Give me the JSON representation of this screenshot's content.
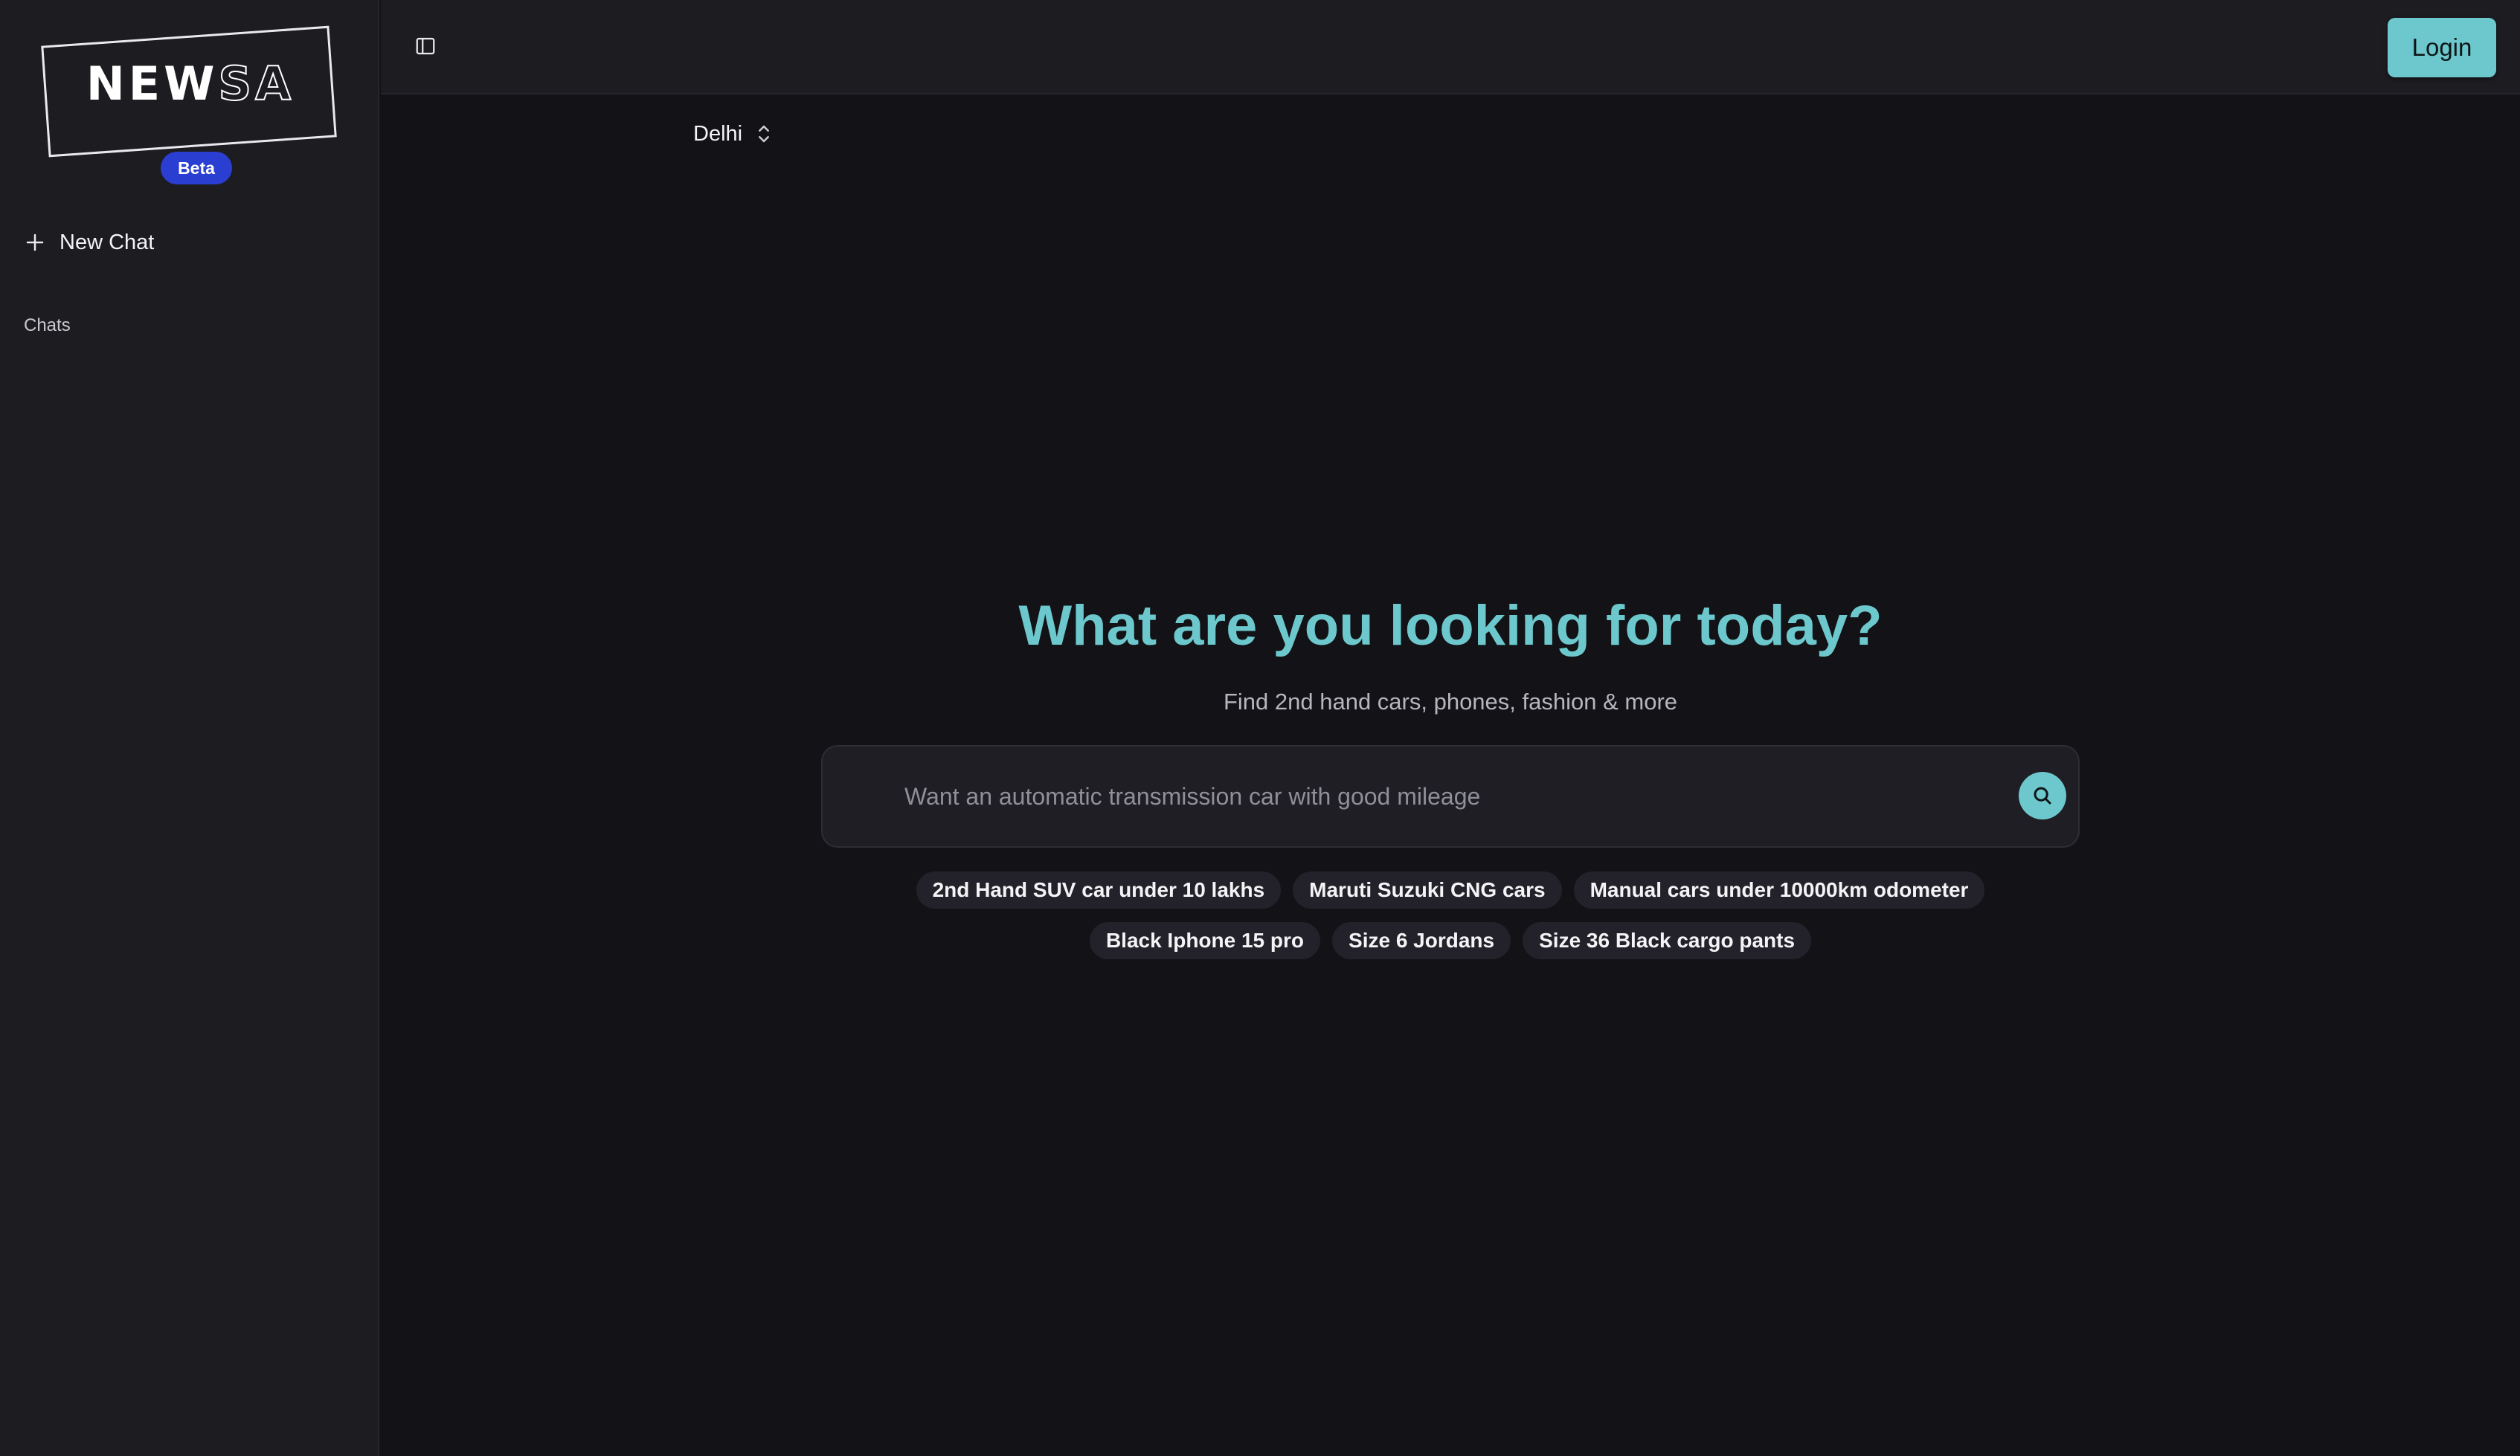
{
  "sidebar": {
    "logo": {
      "part1": "NEW",
      "part2": "SA"
    },
    "badge": "Beta",
    "new_chat_label": "New Chat",
    "chats_label": "Chats"
  },
  "topbar": {
    "login_label": "Login"
  },
  "location": {
    "selected": "Delhi"
  },
  "hero": {
    "title": "What are you looking for today?",
    "subtitle": "Find 2nd hand cars, phones, fashion & more"
  },
  "search": {
    "placeholder": "Want an automatic transmission car with good mileage",
    "value": ""
  },
  "suggestions": {
    "row1": [
      "2nd Hand SUV car under 10 lakhs",
      "Maruti Suzuki CNG cars",
      "Manual cars under 10000km odometer"
    ],
    "row2": [
      "Black Iphone 15 pro",
      "Size 6 Jordans",
      "Size 36 Black cargo pants"
    ]
  },
  "colors": {
    "accent": "#6cc8cc",
    "badge": "#2a3fd1",
    "sidebar_bg": "#1d1c21",
    "main_bg": "#131217"
  },
  "icons": {
    "new_chat": "plus-icon",
    "panel_toggle": "sidebar-toggle-icon",
    "location": "chevron-up-down-icon",
    "search": "search-icon"
  }
}
